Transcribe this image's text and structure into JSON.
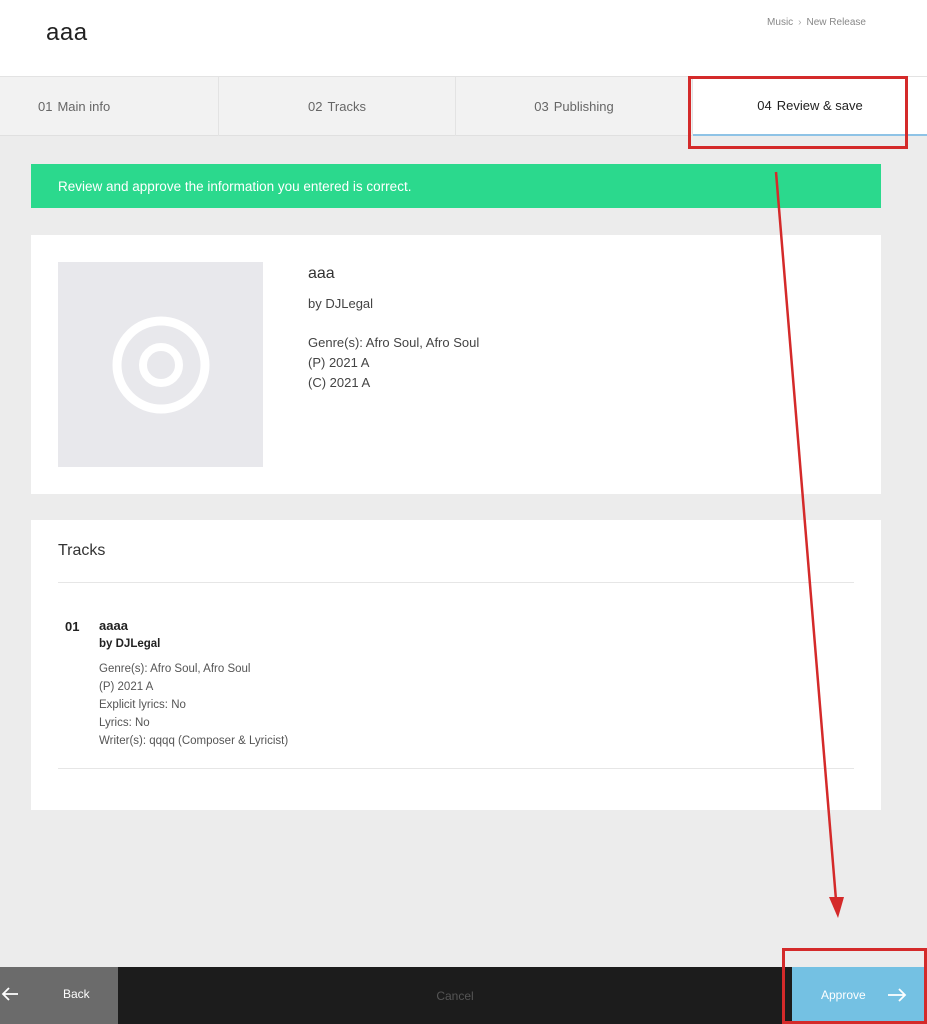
{
  "header": {
    "title": "aaa",
    "breadcrumb": [
      "Music",
      "New Release"
    ],
    "breadcrumb_sep": "›"
  },
  "tabs": [
    {
      "num": "01",
      "label": "Main info"
    },
    {
      "num": "02",
      "label": "Tracks"
    },
    {
      "num": "03",
      "label": "Publishing"
    },
    {
      "num": "04",
      "label": "Review & save"
    }
  ],
  "banner": {
    "text": "Review and approve the information you entered is correct.",
    "color": "#2bd98d"
  },
  "release": {
    "title": "aaa",
    "artist": "by DJLegal",
    "genre": "Genre(s): Afro Soul, Afro Soul",
    "p_line": "(P) 2021 A",
    "c_line": "(C) 2021 A",
    "artwork_icon": "disc-icon"
  },
  "tracks_section": {
    "heading": "Tracks",
    "items": [
      {
        "num": "01",
        "name": "aaaa",
        "artist": "by DJLegal",
        "genre": "Genre(s): Afro Soul, Afro Soul",
        "p_line": "(P) 2021 A",
        "explicit": "Explicit lyrics: No",
        "lyrics": "Lyrics: No",
        "writers": "Writer(s): qqqq (Composer & Lyricist)"
      }
    ]
  },
  "footer": {
    "back_label": "Back",
    "cancel_label": "Cancel",
    "approve_label": "Approve",
    "back_icon": "arrow-left-icon",
    "approve_icon": "arrow-right-icon",
    "approve_color": "#74c1e3"
  },
  "annotation_color": "#d42a2a"
}
